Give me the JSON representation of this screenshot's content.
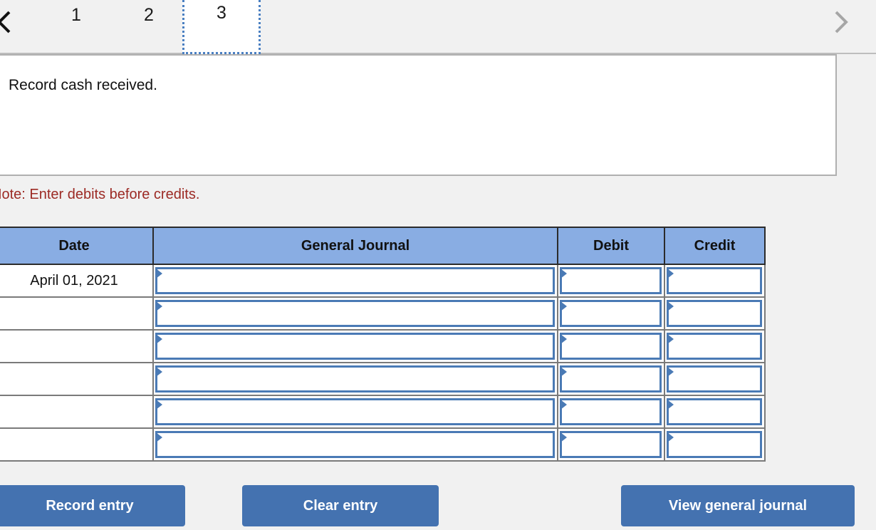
{
  "tabs": {
    "prev_icon": "chevron-left-icon",
    "next_icon": "chevron-right-icon",
    "items": [
      {
        "label": "1",
        "active": false
      },
      {
        "label": "2",
        "active": false
      },
      {
        "label": "3",
        "active": true
      }
    ]
  },
  "prompt": {
    "text": "Record cash received."
  },
  "note": {
    "text": "Note: Enter debits before credits.",
    "color": "#9c2a24"
  },
  "journal": {
    "headers": {
      "date": "Date",
      "general_journal": "General Journal",
      "debit": "Debit",
      "credit": "Credit"
    },
    "header_bg": "#89ade3",
    "rows": [
      {
        "date": "April 01, 2021",
        "general_journal": "",
        "debit": "",
        "credit": ""
      },
      {
        "date": "",
        "general_journal": "",
        "debit": "",
        "credit": ""
      },
      {
        "date": "",
        "general_journal": "",
        "debit": "",
        "credit": ""
      },
      {
        "date": "",
        "general_journal": "",
        "debit": "",
        "credit": ""
      },
      {
        "date": "",
        "general_journal": "",
        "debit": "",
        "credit": ""
      },
      {
        "date": "",
        "general_journal": "",
        "debit": "",
        "credit": ""
      }
    ]
  },
  "buttons": {
    "record": "Record entry",
    "clear": "Clear entry",
    "view": "View general journal",
    "color": "#4472b0"
  }
}
